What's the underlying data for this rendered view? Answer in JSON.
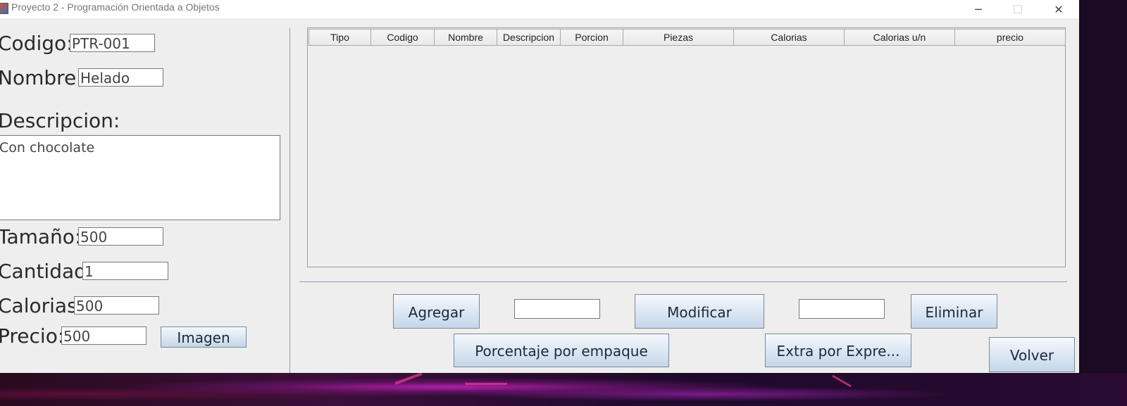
{
  "window": {
    "title": "Proyecto 2 - Programación Orientada a Objetos",
    "minimize": "─",
    "maximize": "☐",
    "close": "✕"
  },
  "form": {
    "codigo": {
      "label": "Codigo:",
      "value": "PTR-001"
    },
    "nombre": {
      "label": "Nombre:",
      "value": "Helado"
    },
    "descripcion": {
      "label": "Descripcion:",
      "value": "Con chocolate"
    },
    "tamano": {
      "label": "Tamaño:",
      "value": "500"
    },
    "cantidad": {
      "label": "Cantidad:",
      "value": "1"
    },
    "calorias": {
      "label": "Calorias:",
      "value": "500"
    },
    "precio": {
      "label": "Precio:",
      "value": "500"
    },
    "imagen_button": "Imagen"
  },
  "table": {
    "columns": [
      "Tipo",
      "Codigo",
      "Nombre",
      "Descripcion",
      "Porcion",
      "Piezas",
      "Calorias",
      "Calorias u/n",
      "precio"
    ],
    "rows": []
  },
  "actions": {
    "agregar": "Agregar",
    "modificar": "Modificar",
    "eliminar": "Eliminar",
    "modificar_input": "",
    "eliminar_input": "",
    "porcentaje": "Porcentaje por empaque",
    "extra": "Extra por Expre...",
    "volver": "Volver"
  }
}
